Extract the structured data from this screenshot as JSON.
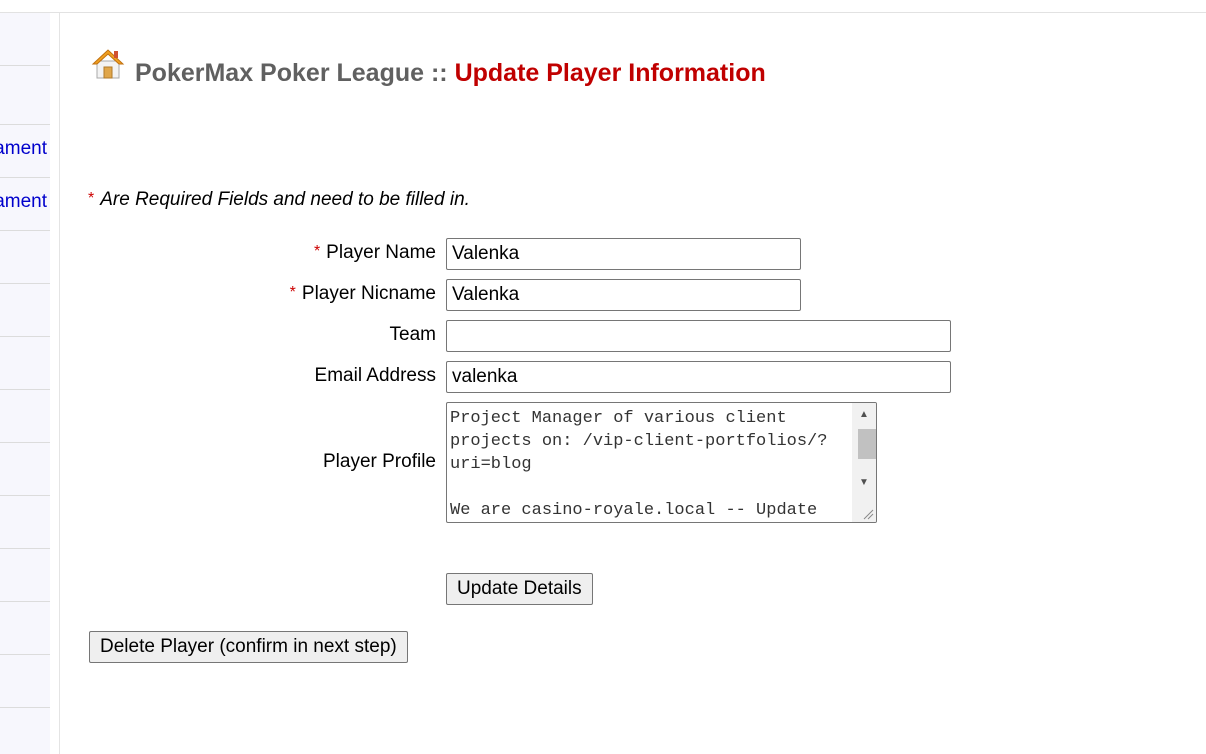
{
  "sidebar": {
    "items": [
      {
        "label": ""
      },
      {
        "label": ""
      },
      {
        "label": "Tournament"
      },
      {
        "label": "Add Tournament"
      },
      {
        "label": ""
      },
      {
        "label": ""
      },
      {
        "label": ""
      },
      {
        "label": ""
      },
      {
        "label": ""
      },
      {
        "label": ""
      },
      {
        "label": ""
      },
      {
        "label": ""
      }
    ]
  },
  "header": {
    "site_name": "PokerMax Poker League",
    "separator": "::",
    "page_title": "Update Player Information",
    "icon": "house-icon"
  },
  "form": {
    "required_star": "*",
    "required_note": "Are Required Fields and need to be filled in.",
    "player_name_label": "Player Name",
    "player_name_value": "Valenka",
    "player_nickname_label": "Player Nicname",
    "player_nickname_value": "Valenka",
    "team_label": "Team",
    "team_value": "",
    "email_label": "Email Address",
    "email_value": "valenka",
    "profile_label": "Player Profile",
    "profile_value": "Project Manager of various client projects on: /vip-client-portfolios/?uri=blog\n\nWe are casino-royale.local -- Update",
    "update_button": "Update Details",
    "delete_button": "Delete Player (confirm in next step)"
  },
  "colors": {
    "accent_title": "#c00000",
    "site_title": "#606060",
    "link": "#0000cc",
    "required_star": "#cc0000"
  }
}
